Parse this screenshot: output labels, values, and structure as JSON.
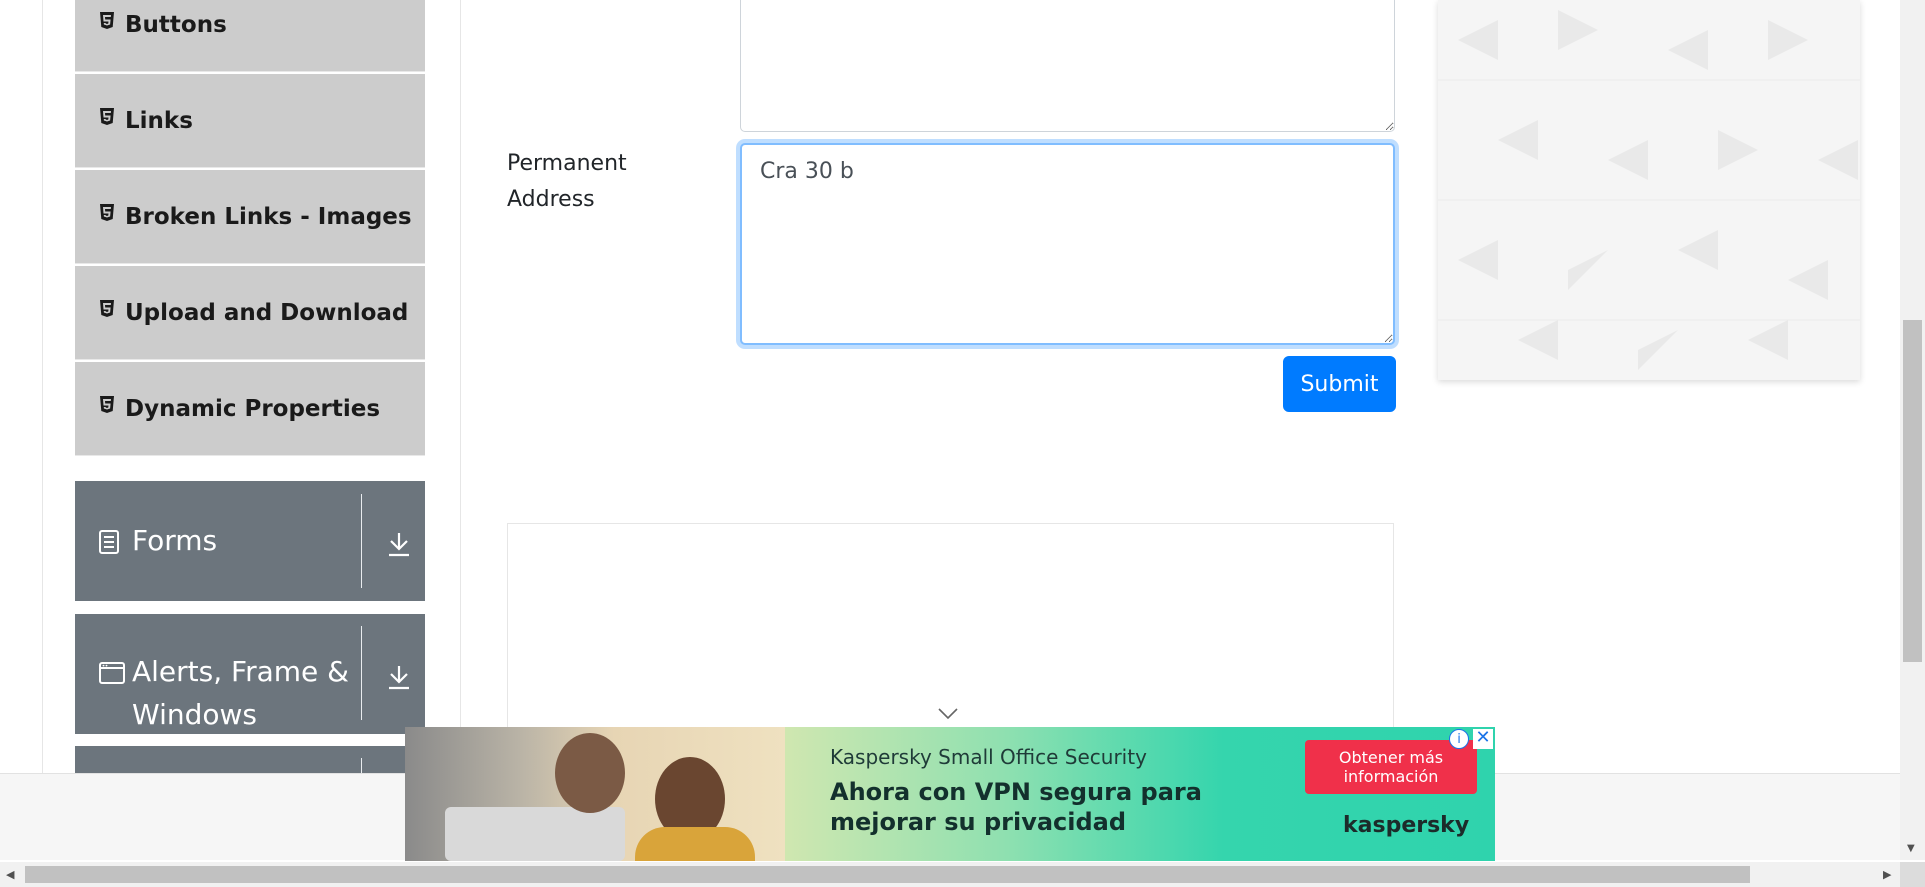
{
  "nav": {
    "items": [
      {
        "label": "Buttons",
        "icon": "html5-icon"
      },
      {
        "label": "Links",
        "icon": "html5-icon"
      },
      {
        "label": "Broken Links - Images",
        "icon": "html5-icon"
      },
      {
        "label": "Upload and Download",
        "icon": "html5-icon"
      },
      {
        "label": "Dynamic Properties",
        "icon": "html5-icon"
      }
    ],
    "groups": [
      {
        "label": "Forms",
        "icon": "document-icon"
      },
      {
        "label_line1": "Alerts, Frame &",
        "label_line2": "Windows",
        "icon": "window-icon"
      }
    ]
  },
  "form": {
    "permanent_address_label_line1": "Permanent",
    "permanent_address_label_line2": "Address",
    "current_address_value": "",
    "permanent_address_value": "Cra 30 b",
    "submit_label": "Submit"
  },
  "ad": {
    "brand_line": "Kaspersky Small Office Security",
    "headline_line1": "Ahora con VPN segura para",
    "headline_line2": "mejorar su privacidad",
    "cta_line1": "Obtener más",
    "cta_line2": "información",
    "logo": "kaspersky",
    "accent": "#2fd3ad",
    "cta_color": "#f0304a"
  },
  "colors": {
    "nav_item_bg": "#cccccc",
    "group_bg": "#6c757d",
    "primary": "#007bff"
  }
}
